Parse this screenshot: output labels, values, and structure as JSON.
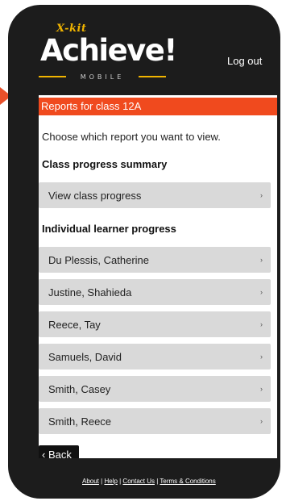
{
  "logo": {
    "brand_prefix": "X-kit",
    "brand": "Achieve!",
    "sub": "MOBILE"
  },
  "header": {
    "logout_label": "Log out"
  },
  "page": {
    "title": "Reports for class 12A",
    "intro": "Choose which report you want to view."
  },
  "class_section": {
    "title": "Class progress summary",
    "items": [
      {
        "label": "View class progress"
      }
    ]
  },
  "learner_section": {
    "title": "Individual learner progress",
    "items": [
      {
        "label": "Du Plessis, Catherine"
      },
      {
        "label": "Justine, Shahieda"
      },
      {
        "label": "Reece, Tay"
      },
      {
        "label": "Samuels, David"
      },
      {
        "label": "Smith, Casey"
      },
      {
        "label": "Smith, Reece"
      }
    ]
  },
  "chevron": "›",
  "back_label": "‹ Back",
  "footer": {
    "links": [
      "About",
      "Help",
      "Contact Us",
      "Terms & Conditions"
    ],
    "separator": " | "
  },
  "colors": {
    "accent": "#f04a1e",
    "brand_yellow": "#f0b400",
    "device": "#1c1c1c"
  }
}
